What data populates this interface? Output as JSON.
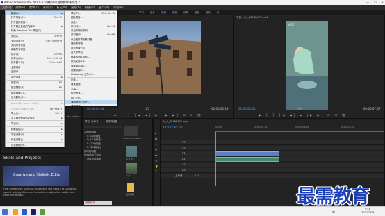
{
  "window": {
    "title": "Adobe Premiere Pro 2020 - D:\\教程\\04\\视频剪辑\\未命名 *",
    "app_icon": "Pr",
    "controls": [
      "—",
      "☐",
      "✕"
    ]
  },
  "menubar": [
    "文件(F)",
    "编辑(E)",
    "剪辑(C)",
    "序列(S)",
    "标记(M)",
    "图形(G)",
    "视图(V)",
    "窗口(W)",
    "帮助(H)"
  ],
  "workspaces": [
    "学习",
    "组件",
    "编辑",
    "颜色",
    "效果",
    "音频",
    "图形",
    "库"
  ],
  "file_menu": [
    {
      "label": "新建(N)",
      "sc": "",
      "arrow": true,
      "hl": true
    },
    {
      "label": "打开项目(O)...",
      "sc": "Ctrl+O"
    },
    {
      "label": "打开团队项目...",
      "sc": ""
    },
    {
      "label": "打开最近使用的内容(E)",
      "sc": "",
      "arrow": true
    },
    {
      "label": "转换 Premiere Clip 项目(C)...",
      "sc": ""
    },
    {
      "sep": true
    },
    {
      "label": "关闭(C)",
      "sc": "Ctrl+W"
    },
    {
      "label": "关闭项目(P)",
      "sc": "Ctrl+Shift+W"
    },
    {
      "label": "关闭所有项目",
      "sc": ""
    },
    {
      "label": "刷新所有项目",
      "sc": ""
    },
    {
      "label": "保存(S)",
      "sc": "Ctrl+S"
    },
    {
      "label": "另存为(A)...",
      "sc": "Ctrl+Shift+S"
    },
    {
      "label": "保存副本(Y)...",
      "sc": "Ctrl+Alt+S"
    },
    {
      "label": "全部保存",
      "sc": ""
    },
    {
      "label": "还原(R)",
      "sc": ""
    },
    {
      "sep": true
    },
    {
      "label": "同步设置",
      "sc": "",
      "arrow": true
    },
    {
      "sep": true
    },
    {
      "label": "捕捉(T)...",
      "sc": "F5"
    },
    {
      "label": "批量捕捉(B)...",
      "sc": "F6"
    },
    {
      "sep": true
    },
    {
      "label": "链接媒体(L)...",
      "sc": ""
    },
    {
      "label": "设为脱机(O)...",
      "sc": ""
    },
    {
      "sep": true
    },
    {
      "label": "Adobe Dynamic Link(K)",
      "sc": "",
      "arrow": true,
      "dis": true
    },
    {
      "sep": true
    },
    {
      "label": "从媒体浏览器导入(M)",
      "sc": "Ctrl+Alt+I",
      "dis": true
    },
    {
      "label": "导入(I)...",
      "sc": "Ctrl+I"
    },
    {
      "label": "导入最近使用的文件(F)",
      "sc": "",
      "arrow": true
    },
    {
      "sep": true
    },
    {
      "label": "导出(E)",
      "sc": "",
      "arrow": true
    },
    {
      "sep": true
    },
    {
      "label": "获取属性(G)",
      "sc": "",
      "arrow": true
    },
    {
      "sep": true
    },
    {
      "label": "项目设置(P)",
      "sc": "",
      "arrow": true
    },
    {
      "label": "作品设置(J)",
      "sc": "",
      "arrow": true
    },
    {
      "sep": true
    },
    {
      "label": "项目管理(M)...",
      "sc": ""
    },
    {
      "sep": true
    },
    {
      "label": "退出(X)",
      "sc": "Ctrl+Q"
    }
  ],
  "new_submenu": [
    {
      "label": "项目(P)...",
      "sc": "Ctrl+Alt+N"
    },
    {
      "label": "团队项目...",
      "sc": ""
    },
    {
      "label": "作品...",
      "sc": ""
    },
    {
      "label": "序列(S)...",
      "sc": "Ctrl+N"
    },
    {
      "label": "来自剪辑的序列",
      "sc": ""
    },
    {
      "label": "素材箱(B)",
      "sc": "Ctrl+B"
    },
    {
      "label": "来自选择项的素材箱",
      "sc": ""
    },
    {
      "label": "搜索素材箱",
      "sc": ""
    },
    {
      "label": "项目快捷方式",
      "sc": ""
    },
    {
      "label": "已共享项目...",
      "sc": ""
    },
    {
      "label": "链接的团队项目...",
      "sc": ""
    },
    {
      "label": "脱机文件(O)...",
      "sc": ""
    },
    {
      "label": "调整图层(A)...",
      "sc": ""
    },
    {
      "label": "旧版标题(T)...",
      "sc": ""
    },
    {
      "label": "Photoshop 文件(H)...",
      "sc": ""
    },
    {
      "sep": true
    },
    {
      "label": "彩条...",
      "sc": ""
    },
    {
      "label": "黑场视频...",
      "sc": ""
    },
    {
      "label": "字幕...",
      "sc": ""
    },
    {
      "label": "颜色遮罩...",
      "sc": ""
    },
    {
      "label": "HD 彩条...",
      "sc": ""
    },
    {
      "label": "通用倒计时片头...",
      "sc": "",
      "hl": true
    },
    {
      "label": "透明视频...",
      "sc": ""
    }
  ],
  "source_monitor": {
    "tab": "源: (无剪辑)",
    "left_tc": "00:00:00:04",
    "right_tc": "00:00:00:19",
    "fit": "1/2"
  },
  "program_monitor": {
    "tab": "节目: hi_2_3026B475.mp4",
    "left_tc": "00:00:00:00",
    "right_tc": "00:00:07:07",
    "fit": "适合",
    "overlay": "抖音"
  },
  "skills": {
    "heading": "Skills and Projects",
    "card_label": "Creative and Stylistic Edits",
    "desc": "Five interactive tutorials that teach the basics of using clip speed, adding titles and transitions, adjusting audio, and color correction.",
    "side_tag": "hic video"
  },
  "project_panel": {
    "tab": "项目: 未命名",
    "tab2": "媒体浏览器",
    "search_placeholder": "",
    "tree": [
      "本地驱动器",
      "C: (本地磁盘)",
      "D: (本地磁盘)",
      "E: (本地磁盘)",
      "F: (本地磁盘)",
      "网络驱动器",
      "Creative Cloud",
      "团队项目版本"
    ],
    "thumbs": [
      "Adobe Premiere...",
      "hi_2_3...",
      "hi_3...",
      "最简教程"
    ],
    "thumb_label": "最需教育"
  },
  "timeline": {
    "tab": "hi_2_3026B475.mp4",
    "timecode": "00:00:00:00",
    "ruler": [
      "00:00",
      "00:00:04:29",
      "00:00:09:29",
      "00:00:14:29"
    ],
    "tracks": [
      "V3",
      "V2",
      "V1",
      "A1",
      "A2",
      "A3",
      "主声道"
    ],
    "master_val": "0.0"
  },
  "taskbar": {
    "time": "9:16",
    "date": "2021/7/28",
    "lang": "英"
  },
  "watermark": "最需教育",
  "colors": {
    "accent_blue": "#4aa0ff",
    "menu_highlight": "#b9d6f2",
    "clip_blue": "#5b7fc8",
    "watermark": "#1a3fb8"
  }
}
